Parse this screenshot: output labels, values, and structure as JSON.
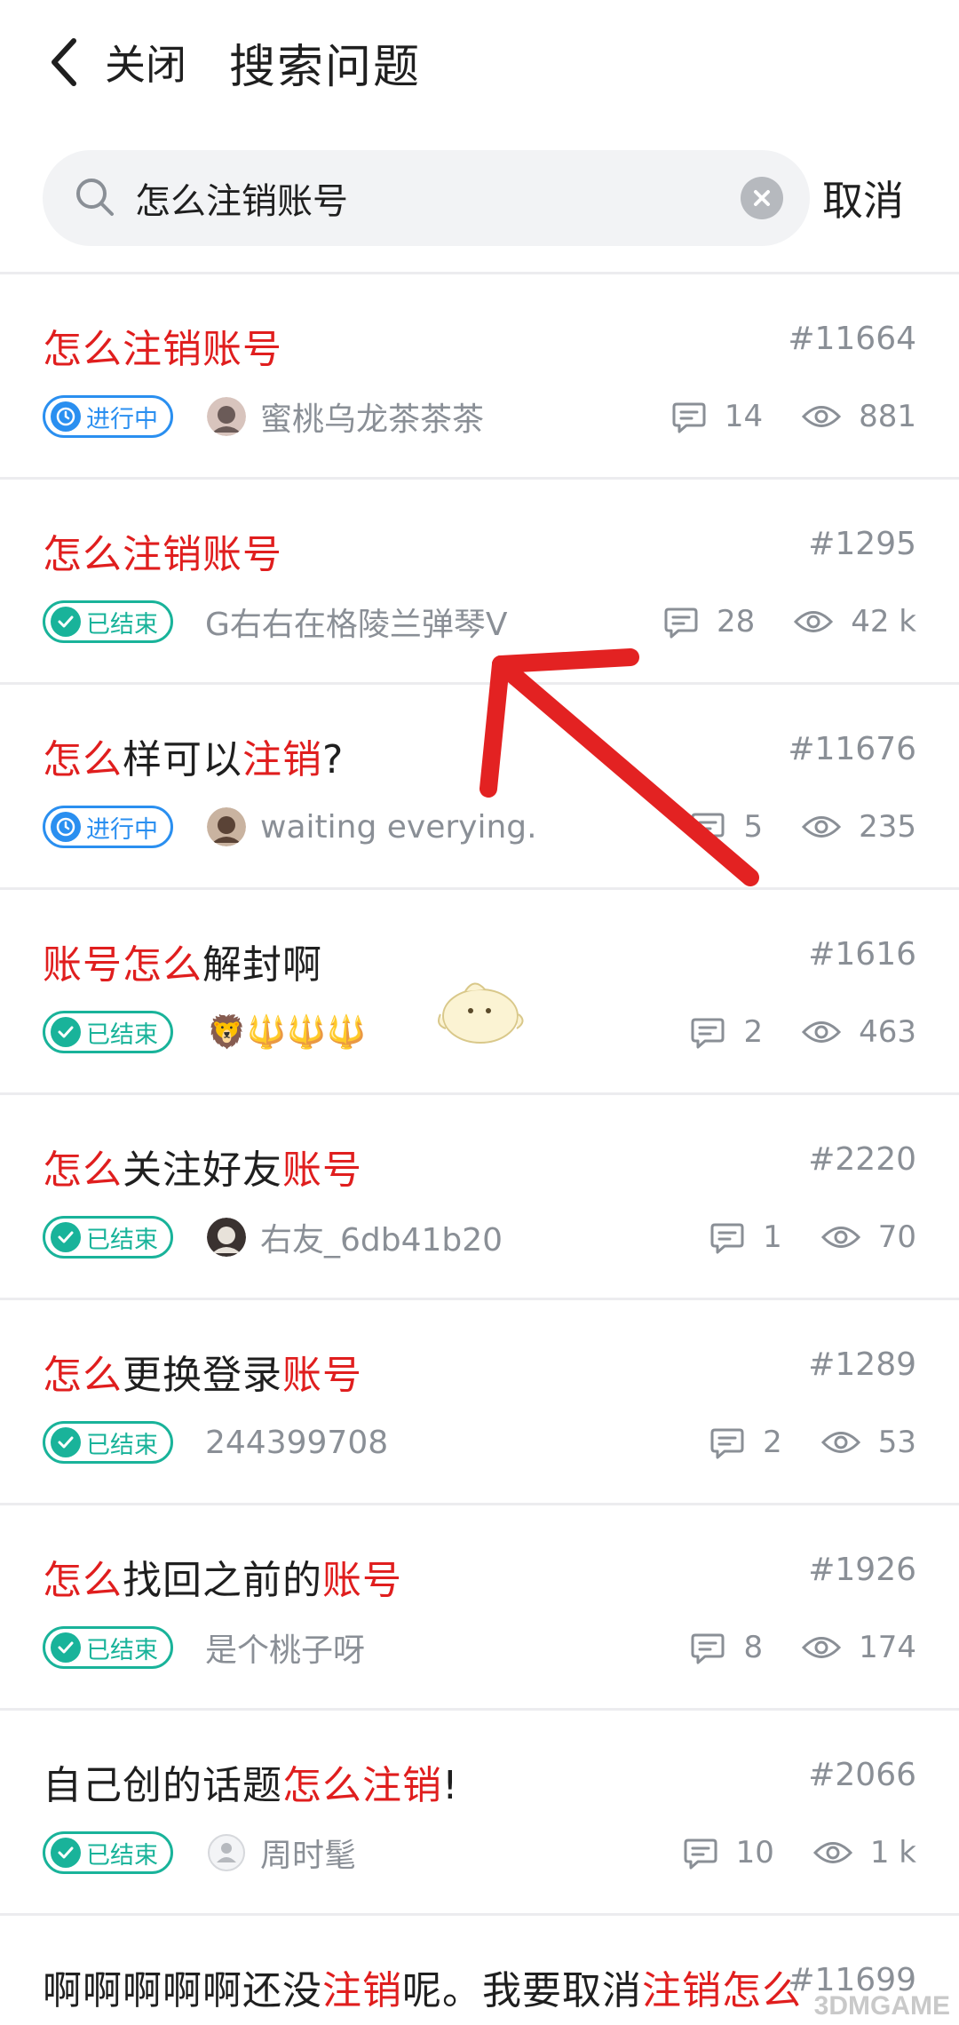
{
  "header": {
    "close_label": "关闭",
    "title": "搜索问题"
  },
  "search": {
    "value": "怎么注销账号",
    "cancel_label": "取消"
  },
  "colors": {
    "highlight": "#e01e1e",
    "in_progress": "#2a8ff0",
    "done": "#19b39a",
    "meta": "#8a8f96"
  },
  "items": [
    {
      "title_parts": [
        {
          "t": "怎么注销账号",
          "h": true
        }
      ],
      "id": "#11664",
      "status": "进行中",
      "status_type": "progress",
      "author": "蜜桃乌龙茶茶茶",
      "avatar": "photo-dark",
      "comments": "14",
      "views": "881"
    },
    {
      "title_parts": [
        {
          "t": "怎么注销账号",
          "h": true
        }
      ],
      "id": "#1295",
      "status": "已结束",
      "status_type": "done",
      "author": "G右右在格陵兰弹琴V",
      "avatar": "",
      "comments": "28",
      "views": "42 k"
    },
    {
      "title_parts": [
        {
          "t": "怎么",
          "h": true
        },
        {
          "t": "样可以",
          "h": false
        },
        {
          "t": "注销",
          "h": true
        },
        {
          "t": "?",
          "h": false
        }
      ],
      "id": "#11676",
      "status": "进行中",
      "status_type": "progress",
      "author": "waiting everying.",
      "avatar": "photo-brown",
      "comments": "5",
      "views": "235"
    },
    {
      "title_parts": [
        {
          "t": "账号怎么",
          "h": true
        },
        {
          "t": "解封啊",
          "h": false
        }
      ],
      "id": "#1616",
      "status": "已结束",
      "status_type": "done",
      "author": "🦁🔱🔱🔱",
      "avatar": "",
      "comments": "2",
      "views": "463"
    },
    {
      "title_parts": [
        {
          "t": "怎么",
          "h": true
        },
        {
          "t": "关注好友",
          "h": false
        },
        {
          "t": "账号",
          "h": true
        }
      ],
      "id": "#2220",
      "status": "已结束",
      "status_type": "done",
      "author": "右友_6db41b20",
      "avatar": "photo-child",
      "comments": "1",
      "views": "70"
    },
    {
      "title_parts": [
        {
          "t": "怎么",
          "h": true
        },
        {
          "t": "更换登录",
          "h": false
        },
        {
          "t": "账号",
          "h": true
        }
      ],
      "id": "#1289",
      "status": "已结束",
      "status_type": "done",
      "author": "244399708",
      "avatar": "",
      "comments": "2",
      "views": "53"
    },
    {
      "title_parts": [
        {
          "t": "怎么",
          "h": true
        },
        {
          "t": "找回之前的",
          "h": false
        },
        {
          "t": "账号",
          "h": true
        }
      ],
      "id": "#1926",
      "status": "已结束",
      "status_type": "done",
      "author": "是个桃子呀",
      "avatar": "",
      "comments": "8",
      "views": "174"
    },
    {
      "title_parts": [
        {
          "t": "自己创的话题",
          "h": false
        },
        {
          "t": "怎么注销",
          "h": true
        },
        {
          "t": "!",
          "h": false
        }
      ],
      "id": "#2066",
      "status": "已结束",
      "status_type": "done",
      "author": "周时髦",
      "avatar": "default-person",
      "comments": "10",
      "views": "1 k"
    },
    {
      "title_parts": [
        {
          "t": "啊啊啊啊啊还没",
          "h": false
        },
        {
          "t": "注销",
          "h": true
        },
        {
          "t": "呢。我要取消",
          "h": false
        },
        {
          "t": "注销怎么",
          "h": true
        }
      ],
      "id": "#11699",
      "status": "",
      "status_type": "",
      "author": "",
      "avatar": "",
      "comments": "",
      "views": ""
    }
  ],
  "watermark": "3DMGAME"
}
